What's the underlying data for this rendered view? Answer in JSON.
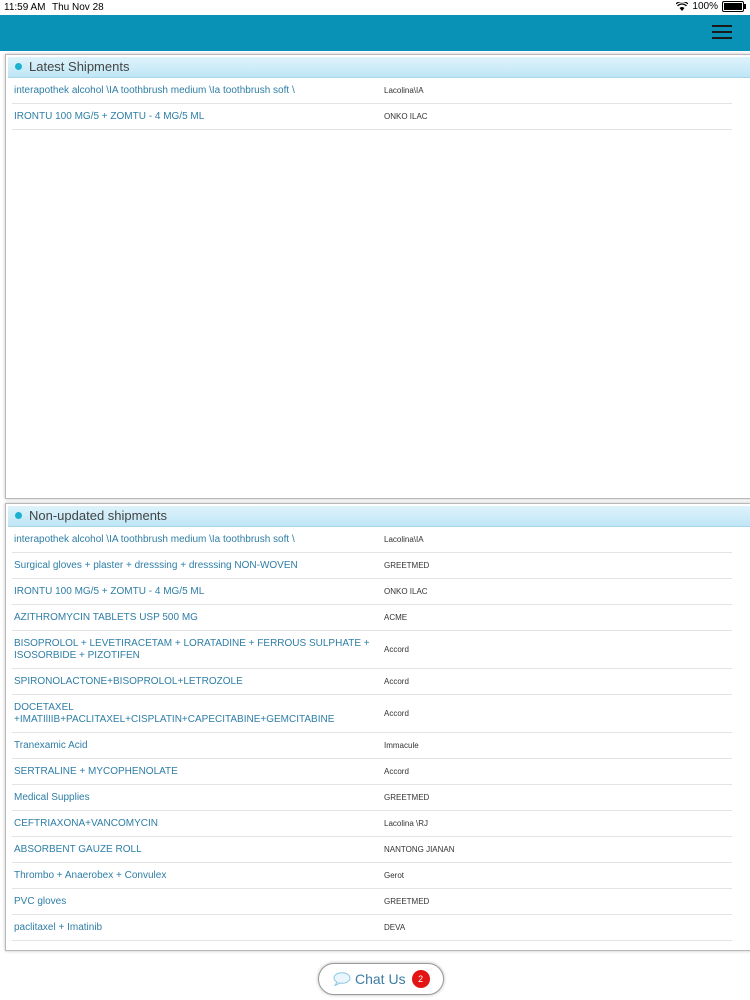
{
  "status": {
    "time": "11:59 AM",
    "date": "Thu Nov 28",
    "battery": "100%"
  },
  "colors": {
    "navbar": "#0a92b6",
    "link_text": "#2e7ea6",
    "badge": "#e31414"
  },
  "latest": {
    "title": "Latest Shipments",
    "rows": [
      {
        "name": "interapothek alcohol \\IA toothbrush medium \\Ia toothbrush soft \\",
        "vendor": "Lacolina\\IA"
      },
      {
        "name": "IRONTU 100 MG/5 + ZOMTU - 4 MG/5 ML",
        "vendor": "ONKO ILAC"
      }
    ]
  },
  "nonupdated": {
    "title": "Non-updated shipments",
    "rows": [
      {
        "name": "interapothek alcohol \\IA toothbrush medium \\Ia toothbrush soft \\",
        "vendor": "Lacolina\\IA"
      },
      {
        "name": " Surgical gloves + plaster + dresssing +  dresssing NON-WOVEN",
        "vendor": "GREETMED"
      },
      {
        "name": "IRONTU 100 MG/5 + ZOMTU - 4 MG/5 ML",
        "vendor": "ONKO ILAC"
      },
      {
        "name": "AZITHROMYCIN TABLETS USP 500 MG",
        "vendor": "ACME"
      },
      {
        "name": "BISOPROLOL + LEVETIRACETAM + LORATADINE + FERROUS SULPHATE + ISOSORBIDE + PIZOTIFEN",
        "vendor": "Accord"
      },
      {
        "name": "SPIRONOLACTONE+BISOPROLOL+LETROZOLE",
        "vendor": "Accord"
      },
      {
        "name": "DOCETAXEL +IMATIlIIB+PACLITAXEL+CISPLATIN+CAPECITABINE+GEMCITABINE",
        "vendor": "Accord"
      },
      {
        "name": " Tranexamic Acid",
        "vendor": "Immacule"
      },
      {
        "name": "SERTRALINE  + MYCOPHENOLATE",
        "vendor": "Accord"
      },
      {
        "name": "Medical Supplies",
        "vendor": "GREETMED"
      },
      {
        "name": "CEFTRIAXONA+VANCOMYCIN",
        "vendor": "Lacolina \\RJ"
      },
      {
        "name": "ABSORBENT GAUZE ROLL",
        "vendor": "NANTONG JIANAN"
      },
      {
        "name": "Thrombo + Anaerobex + Convulex",
        "vendor": "Gerot"
      },
      {
        "name": "PVC gloves",
        "vendor": "GREETMED"
      },
      {
        "name": "paclitaxel + Imatinib",
        "vendor": "DEVA"
      }
    ]
  },
  "chat": {
    "label": "Chat Us",
    "badge": "2"
  }
}
